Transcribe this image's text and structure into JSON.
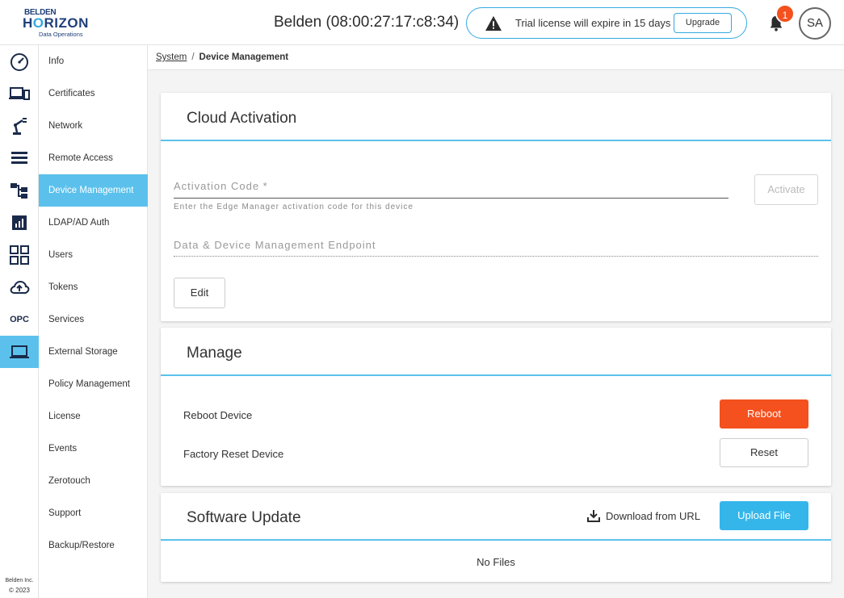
{
  "header": {
    "logo": {
      "line1": "BELDEN",
      "line2a": "H",
      "line2b": "O",
      "line2c": "RIZON",
      "line3": "Data Operations"
    },
    "device_title": "Belden (08:00:27:17:c8:34)",
    "trial_text": "Trial license will expire in 15 days",
    "upgrade_label": "Upgrade",
    "notification_count": "1",
    "avatar_initials": "SA"
  },
  "rail": {
    "icons": [
      "dashboard-icon",
      "devices-icon",
      "robot-arm-icon",
      "list-icon",
      "hierarchy-icon",
      "report-icon",
      "apps-grid-icon",
      "cloud-upload-icon",
      "opc-icon",
      "laptop-icon"
    ],
    "opc_label": "OPC",
    "active_icon": "laptop-icon",
    "footer_company": "Belden Inc.",
    "footer_year": "© 2023"
  },
  "subnav": {
    "items": [
      "Info",
      "Certificates",
      "Network",
      "Remote Access",
      "Device Management",
      "LDAP/AD Auth",
      "Users",
      "Tokens",
      "Services",
      "External Storage",
      "Policy Management",
      "License",
      "Events",
      "Zerotouch",
      "Support",
      "Backup/Restore"
    ],
    "active": "Device Management"
  },
  "breadcrumb": {
    "parent": "System",
    "separator": "/",
    "current": "Device Management"
  },
  "cloud_activation": {
    "title": "Cloud Activation",
    "activation_code_label": "Activation Code *",
    "activation_code_hint": "Enter the Edge Manager activation code for this device",
    "activate_label": "Activate",
    "endpoint_label": "Data & Device Management Endpoint",
    "edit_label": "Edit"
  },
  "manage": {
    "title": "Manage",
    "reboot_row_label": "Reboot Device",
    "reboot_button": "Reboot",
    "reset_row_label": "Factory Reset Device",
    "reset_button": "Reset"
  },
  "software_update": {
    "title": "Software Update",
    "download_label": "Download from URL",
    "upload_label": "Upload File",
    "empty_text": "No Files"
  },
  "colors": {
    "accent": "#5bc1ec",
    "brand": "#1f3f7a",
    "danger": "#f4511e",
    "primary_button": "#35b6ea"
  }
}
